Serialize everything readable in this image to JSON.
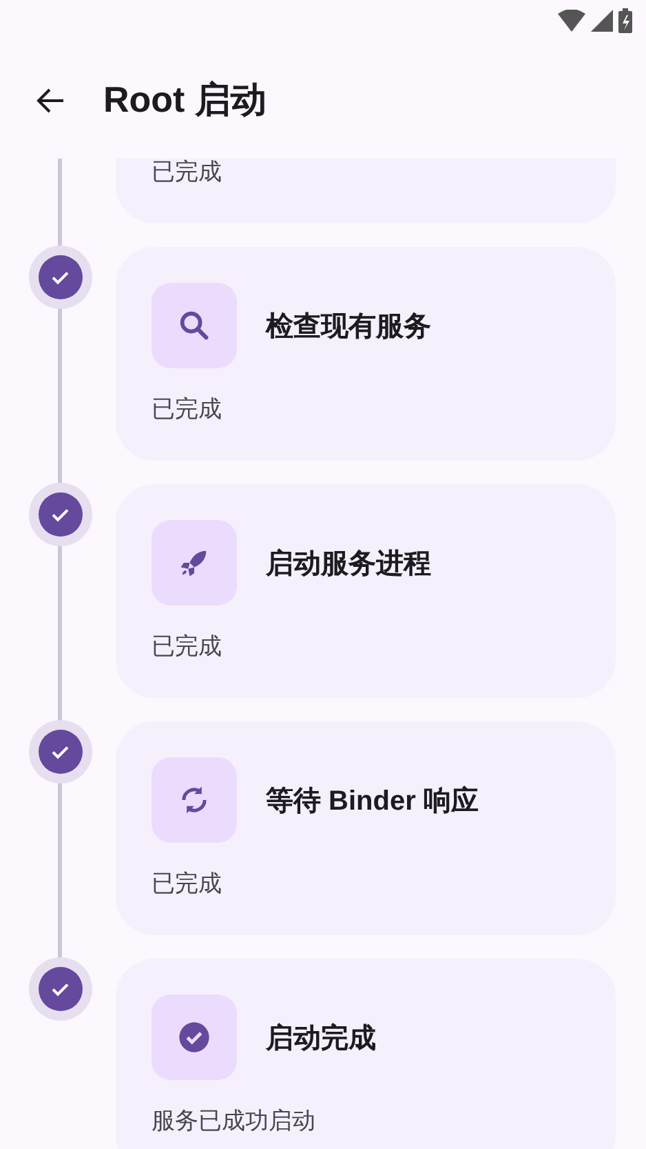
{
  "app_bar": {
    "title": "Root 启动"
  },
  "steps": [
    {
      "kind": "partial",
      "status": "已完成"
    },
    {
      "kind": "search",
      "title": "检查现有服务",
      "status": "已完成"
    },
    {
      "kind": "rocket",
      "title": "启动服务进程",
      "status": "已完成"
    },
    {
      "kind": "sync",
      "title": "等待 Binder 响应",
      "status": "已完成"
    },
    {
      "kind": "check",
      "title": "启动完成",
      "status": "服务已成功启动"
    }
  ]
}
